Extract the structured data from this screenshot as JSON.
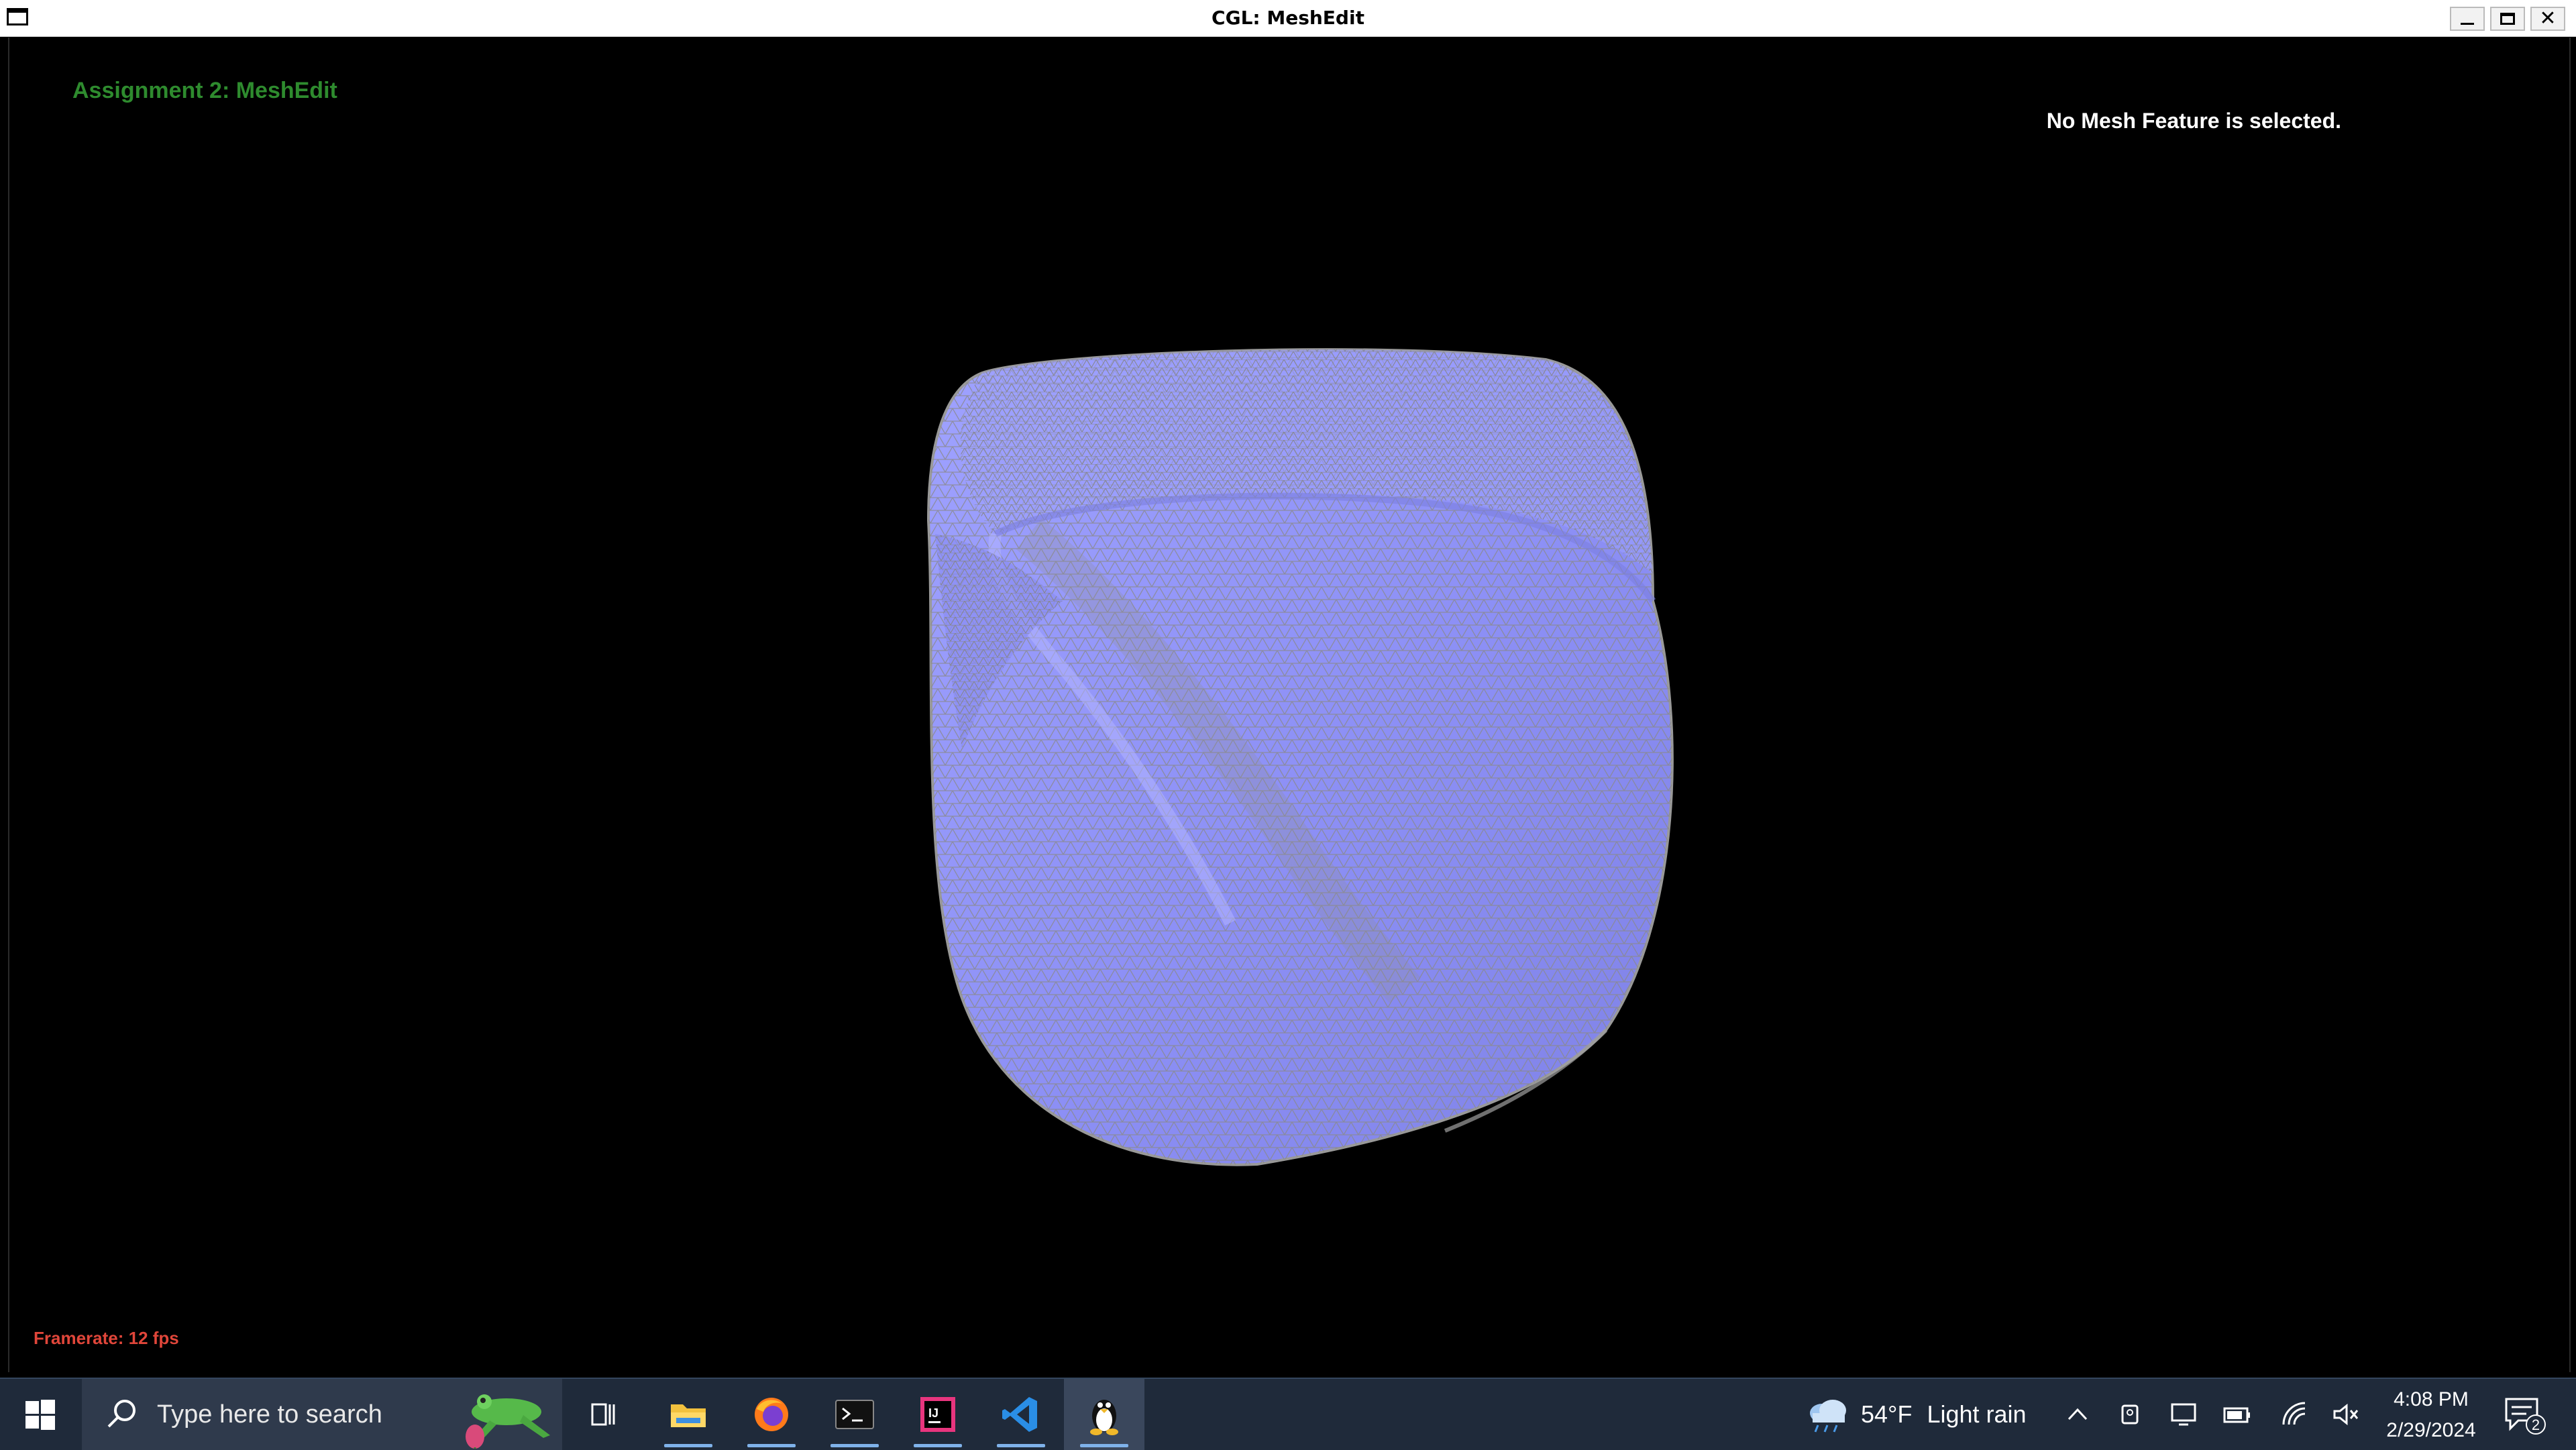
{
  "window": {
    "title": "CGL: MeshEdit"
  },
  "hud": {
    "assignment": "Assignment 2: MeshEdit",
    "selection_status": "No Mesh Feature is selected.",
    "framerate": "Framerate: 12 fps"
  },
  "colors": {
    "mesh_fill": "#8c8ff5",
    "mesh_wire": "#8a8a8a",
    "assignment_text": "#2e8b2e",
    "framerate_text": "#e0463a",
    "taskbar": "#1f2a3a"
  },
  "taskbar": {
    "search_placeholder": "Type here to search",
    "apps": [
      {
        "name": "task-view",
        "icon": "task-view-icon"
      },
      {
        "name": "file-explorer",
        "icon": "folder-icon",
        "running": true
      },
      {
        "name": "firefox",
        "icon": "firefox-icon",
        "running": true
      },
      {
        "name": "terminal",
        "icon": "terminal-icon",
        "running": true
      },
      {
        "name": "intellij",
        "icon": "intellij-icon",
        "running": true
      },
      {
        "name": "vscode",
        "icon": "vscode-icon",
        "running": true
      },
      {
        "name": "linux-app",
        "icon": "tux-icon",
        "running": true,
        "active": true
      }
    ],
    "weather": {
      "temperature": "54°F",
      "condition": "Light rain",
      "icon": "cloud-rain-icon"
    },
    "tray_icons": [
      "chevron-up-icon",
      "camera-icon",
      "monitor-icon",
      "battery-icon",
      "wifi-icon",
      "speaker-muted-icon"
    ],
    "clock": {
      "time": "4:08 PM",
      "date": "2/29/2024"
    },
    "notifications": {
      "count": "2"
    }
  }
}
